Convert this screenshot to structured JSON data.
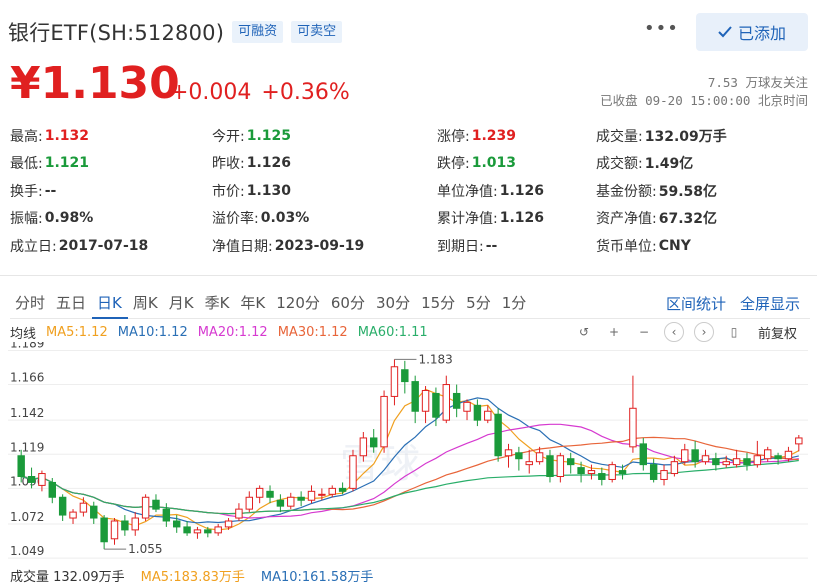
{
  "header": {
    "title": "银行ETF(SH:512800)",
    "tags": [
      "可融资",
      "可卖空"
    ],
    "more_icon": "more-horizontal-icon",
    "add_button_label": "已添加",
    "add_button_icon": "check-icon"
  },
  "price": {
    "current": "¥1.130",
    "change": "+0.004",
    "change_pct": "+0.36%",
    "followers": "7.53 万球友关注",
    "status": "已收盘 09-20 15:00:00 北京时间"
  },
  "quote": [
    [
      {
        "k": "最高:",
        "v": "1.132",
        "c": "red"
      },
      {
        "k": "今开:",
        "v": "1.125",
        "c": "green"
      },
      {
        "k": "涨停:",
        "v": "1.239",
        "c": "red"
      },
      {
        "k": "成交量:",
        "v": "132.09万手",
        "c": ""
      }
    ],
    [
      {
        "k": "最低:",
        "v": "1.121",
        "c": "green"
      },
      {
        "k": "昨收:",
        "v": "1.126",
        "c": ""
      },
      {
        "k": "跌停:",
        "v": "1.013",
        "c": "green"
      },
      {
        "k": "成交额:",
        "v": "1.49亿",
        "c": ""
      }
    ],
    [
      {
        "k": "换手:",
        "v": "--",
        "c": ""
      },
      {
        "k": "市价:",
        "v": "1.130",
        "c": ""
      },
      {
        "k": "单位净值:",
        "v": "1.126",
        "c": ""
      },
      {
        "k": "基金份额:",
        "v": "59.58亿",
        "c": ""
      }
    ],
    [
      {
        "k": "振幅:",
        "v": "0.98%",
        "c": ""
      },
      {
        "k": "溢价率:",
        "v": "0.03%",
        "c": ""
      },
      {
        "k": "累计净值:",
        "v": "1.126",
        "c": ""
      },
      {
        "k": "资产净值:",
        "v": "67.32亿",
        "c": ""
      }
    ],
    [
      {
        "k": "成立日:",
        "v": "2017-07-18",
        "c": ""
      },
      {
        "k": "净值日期:",
        "v": "2023-09-19",
        "c": ""
      },
      {
        "k": "到期日:",
        "v": "--",
        "c": ""
      },
      {
        "k": "货币单位:",
        "v": "CNY",
        "c": ""
      }
    ]
  ],
  "periods": [
    "分时",
    "五日",
    "日K",
    "周K",
    "月K",
    "季K",
    "年K",
    "120分",
    "60分",
    "30分",
    "15分",
    "5分",
    "1分"
  ],
  "active_period": "日K",
  "period_links": [
    "区间统计",
    "全屏显示"
  ],
  "legend": {
    "label": "均线",
    "items": [
      {
        "text": "MA5:1.12",
        "color": "#f0a020"
      },
      {
        "text": "MA10:1.12",
        "color": "#2a6fb5"
      },
      {
        "text": "MA20:1.12",
        "color": "#d63ad0"
      },
      {
        "text": "MA30:1.12",
        "color": "#e8653a"
      },
      {
        "text": "MA60:1.11",
        "color": "#2aae6a"
      }
    ]
  },
  "controls": {
    "icons": [
      "undo-icon",
      "zoom-in-icon",
      "zoom-out-icon",
      "prev-icon",
      "next-icon",
      "candle-icon"
    ],
    "adjust_label": "前复权"
  },
  "chart_data": {
    "type": "candlestick",
    "ylim": [
      1.045,
      1.192
    ],
    "yticks": [
      "1.189",
      "1.166",
      "1.142",
      "1.119",
      "1.096",
      "1.072",
      "1.049"
    ],
    "high_label": "1.183",
    "low_label": "1.055",
    "candles": [
      [
        1.118,
        1.104,
        1.122,
        1.1
      ],
      [
        1.104,
        1.1,
        1.11,
        1.096
      ],
      [
        1.098,
        1.106,
        1.108,
        1.094
      ],
      [
        1.1,
        1.09,
        1.103,
        1.086
      ],
      [
        1.09,
        1.078,
        1.092,
        1.074
      ],
      [
        1.076,
        1.08,
        1.082,
        1.072
      ],
      [
        1.08,
        1.086,
        1.09,
        1.077
      ],
      [
        1.084,
        1.076,
        1.087,
        1.072
      ],
      [
        1.076,
        1.06,
        1.078,
        1.055
      ],
      [
        1.062,
        1.074,
        1.076,
        1.058
      ],
      [
        1.074,
        1.068,
        1.078,
        1.064
      ],
      [
        1.068,
        1.076,
        1.08,
        1.064
      ],
      [
        1.076,
        1.09,
        1.092,
        1.074
      ],
      [
        1.088,
        1.082,
        1.092,
        1.08
      ],
      [
        1.082,
        1.074,
        1.086,
        1.07
      ],
      [
        1.074,
        1.07,
        1.078,
        1.066
      ],
      [
        1.07,
        1.066,
        1.074,
        1.064
      ],
      [
        1.066,
        1.068,
        1.07,
        1.062
      ],
      [
        1.068,
        1.066,
        1.07,
        1.063
      ],
      [
        1.066,
        1.07,
        1.072,
        1.064
      ],
      [
        1.07,
        1.074,
        1.076,
        1.068
      ],
      [
        1.076,
        1.082,
        1.086,
        1.074
      ],
      [
        1.082,
        1.09,
        1.094,
        1.08
      ],
      [
        1.09,
        1.096,
        1.098,
        1.086
      ],
      [
        1.094,
        1.09,
        1.098,
        1.086
      ],
      [
        1.088,
        1.084,
        1.092,
        1.08
      ],
      [
        1.084,
        1.09,
        1.093,
        1.082
      ],
      [
        1.09,
        1.088,
        1.094,
        1.084
      ],
      [
        1.088,
        1.094,
        1.098,
        1.086
      ],
      [
        1.092,
        1.092,
        1.096,
        1.088
      ],
      [
        1.092,
        1.096,
        1.098,
        1.09
      ],
      [
        1.096,
        1.094,
        1.1,
        1.092
      ],
      [
        1.096,
        1.118,
        1.122,
        1.094
      ],
      [
        1.118,
        1.13,
        1.134,
        1.114
      ],
      [
        1.13,
        1.124,
        1.136,
        1.12
      ],
      [
        1.124,
        1.158,
        1.162,
        1.12
      ],
      [
        1.158,
        1.178,
        1.183,
        1.152
      ],
      [
        1.176,
        1.168,
        1.182,
        1.16
      ],
      [
        1.168,
        1.148,
        1.172,
        1.14
      ],
      [
        1.148,
        1.162,
        1.165,
        1.14
      ],
      [
        1.16,
        1.144,
        1.164,
        1.138
      ],
      [
        1.142,
        1.166,
        1.172,
        1.14
      ],
      [
        1.16,
        1.15,
        1.166,
        1.144
      ],
      [
        1.148,
        1.154,
        1.156,
        1.142
      ],
      [
        1.152,
        1.142,
        1.156,
        1.138
      ],
      [
        1.142,
        1.148,
        1.152,
        1.14
      ],
      [
        1.146,
        1.118,
        1.15,
        1.114
      ],
      [
        1.118,
        1.122,
        1.126,
        1.11
      ],
      [
        1.12,
        1.116,
        1.124,
        1.108
      ],
      [
        1.112,
        1.114,
        1.122,
        1.106
      ],
      [
        1.114,
        1.12,
        1.124,
        1.112
      ],
      [
        1.118,
        1.104,
        1.122,
        1.1
      ],
      [
        1.104,
        1.118,
        1.12,
        1.1
      ],
      [
        1.116,
        1.112,
        1.12,
        1.106
      ],
      [
        1.11,
        1.106,
        1.114,
        1.1
      ],
      [
        1.106,
        1.108,
        1.112,
        1.102
      ],
      [
        1.106,
        1.102,
        1.11,
        1.098
      ],
      [
        1.102,
        1.112,
        1.114,
        1.1
      ],
      [
        1.108,
        1.106,
        1.112,
        1.102
      ],
      [
        1.124,
        1.15,
        1.172,
        1.12
      ],
      [
        1.126,
        1.112,
        1.13,
        1.108
      ],
      [
        1.112,
        1.102,
        1.116,
        1.1
      ],
      [
        1.102,
        1.108,
        1.112,
        1.098
      ],
      [
        1.106,
        1.114,
        1.118,
        1.104
      ],
      [
        1.114,
        1.122,
        1.126,
        1.112
      ],
      [
        1.122,
        1.114,
        1.128,
        1.11
      ],
      [
        1.114,
        1.118,
        1.122,
        1.112
      ],
      [
        1.116,
        1.112,
        1.12,
        1.108
      ],
      [
        1.112,
        1.114,
        1.118,
        1.11
      ],
      [
        1.112,
        1.116,
        1.122,
        1.11
      ],
      [
        1.116,
        1.112,
        1.12,
        1.108
      ],
      [
        1.112,
        1.118,
        1.128,
        1.11
      ],
      [
        1.116,
        1.122,
        1.124,
        1.114
      ],
      [
        1.118,
        1.116,
        1.12,
        1.112
      ],
      [
        1.116,
        1.121,
        1.124,
        1.114
      ],
      [
        1.126,
        1.13,
        1.132,
        1.121
      ]
    ]
  },
  "volume": {
    "label": "成交量 132.09万手",
    "ma5": "MA5:183.83万手",
    "ma10": "MA10:161.58万手",
    "ma5_color": "#f0a020",
    "ma10_color": "#2a6fb5"
  },
  "colors": {
    "up": "#e02020",
    "down": "#1a9a3a",
    "accent": "#1f63b8"
  }
}
